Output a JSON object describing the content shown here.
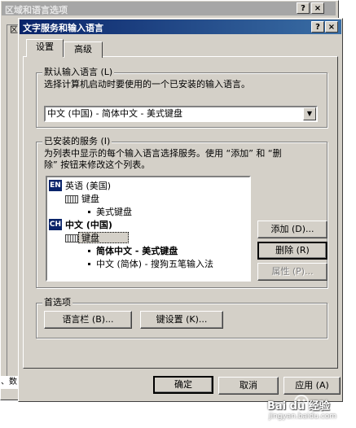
{
  "outer_dialog": {
    "title": "区域和语言选项",
    "help_btn": "?",
    "close_btn": "×",
    "tab_stub": "区",
    "bottom_text": "、数"
  },
  "dialog": {
    "title": "文字服务和输入语言",
    "help_btn": "?",
    "close_btn": "×"
  },
  "tabs": [
    {
      "label": "设置"
    },
    {
      "label": "高级"
    }
  ],
  "default_lang": {
    "group_label": "默认输入语言 (L)",
    "description": "选择计算机启动时要使用的一个已安装的输入语言。",
    "selected": "中文 (中国) - 简体中文 - 美式键盘",
    "dropdown_arrow": "▼"
  },
  "installed": {
    "group_label": "已安装的服务 (I)",
    "description_line1": "为列表中显示的每个输入语言选择服务。使用 “添加” 和 “删",
    "description_line2": "除” 按钮来修改这个列表。",
    "tree": [
      {
        "badge": "EN",
        "language": "英语 (美国)",
        "category": "键盘",
        "items": [
          "美式键盘"
        ]
      },
      {
        "badge": "CH",
        "language": "中文 (中国)",
        "category": "键盘",
        "items": [
          "简体中文 - 美式键盘",
          "中文 (简体) - 搜狗五笔输入法"
        ]
      }
    ],
    "add_btn": "添加 (D)...",
    "remove_btn": "删除 (R)",
    "props_btn": "属性 (P)..."
  },
  "prefs": {
    "group_label": "首选项",
    "langbar_btn": "语言栏 (B)...",
    "keyset_btn": "键设置 (K)..."
  },
  "footer": {
    "ok": "确定",
    "cancel": "取消",
    "apply": "应用 (A)"
  },
  "watermark": {
    "brand": "Bai du 经验",
    "url": "jingyan.baidu.com"
  }
}
